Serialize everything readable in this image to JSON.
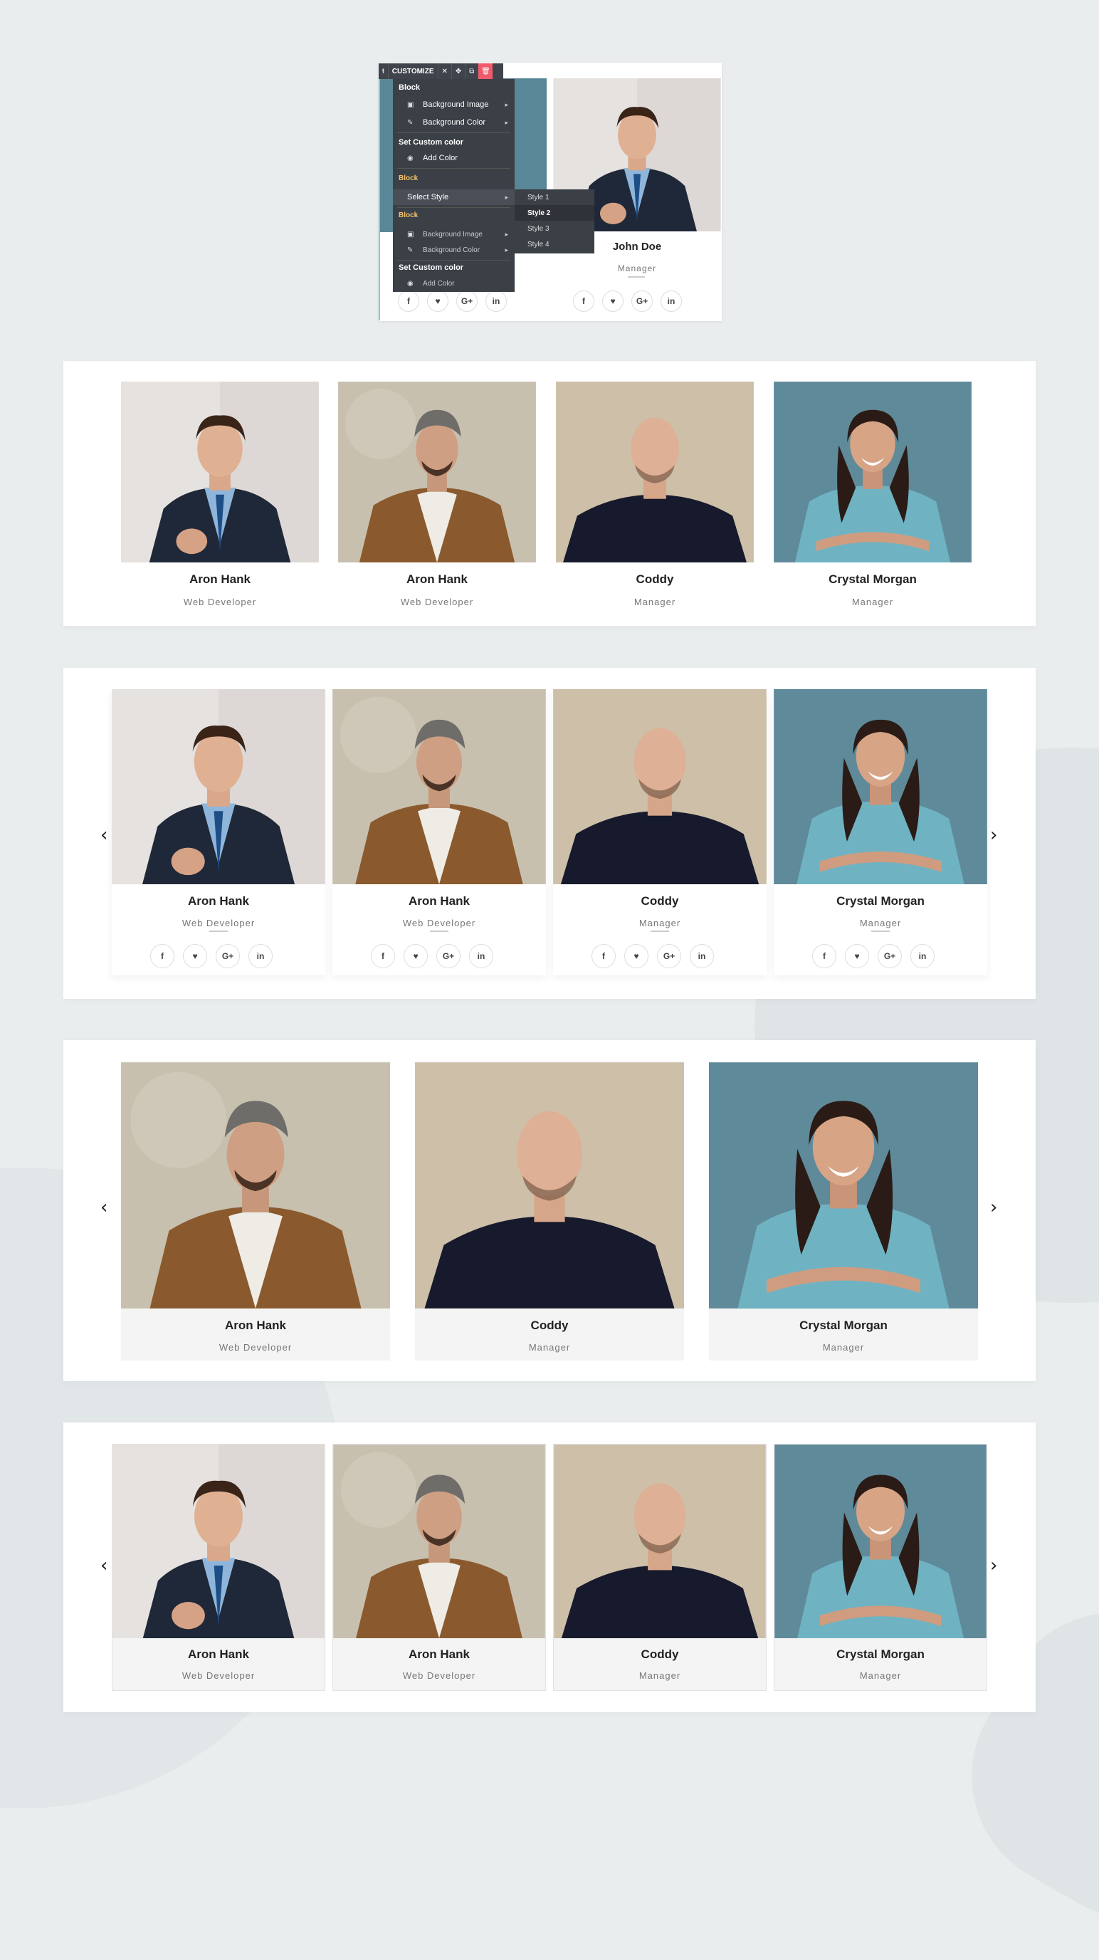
{
  "editor": {
    "toolbar": {
      "handle": "ŧ",
      "customize": "CUSTOMIZE",
      "close": "✕",
      "move": "✥",
      "copy": "⧉",
      "delete": "🗑"
    },
    "menu": {
      "block_header": "Block",
      "bg_image": "Background Image",
      "bg_color": "Background Color",
      "custom_color_header": "Set Custom color",
      "add_color": "Add Color",
      "block_sub_1": "Block",
      "select_style": "Select Style",
      "block_sub_2": "Block",
      "bg_image_2": "Background Image",
      "bg_color_2": "Background Color",
      "custom_color_header_2": "Set Custom color",
      "add_color_2": "Add Color"
    },
    "submenu": [
      "Style 1",
      "Style 2",
      "Style 3",
      "Style 4"
    ],
    "selected_style": "Style 2",
    "card": {
      "name": "John Doe",
      "role": "Manager"
    }
  },
  "social": {
    "facebook": "f",
    "twitter": "♥",
    "google": "G+",
    "linkedin": "in"
  },
  "navigation": {
    "prev": "‹",
    "next": "›"
  },
  "members": {
    "aron": {
      "name": "Aron Hank",
      "role": "Web Developer"
    },
    "coddy": {
      "name": "Coddy",
      "role": "Manager"
    },
    "crystal": {
      "name": "Crystal Morgan",
      "role": "Manager"
    }
  },
  "colors": {
    "accent_delete": "#f05a6b",
    "menu_bg": "#3b3f46",
    "teal_bg": "#5a8797"
  }
}
